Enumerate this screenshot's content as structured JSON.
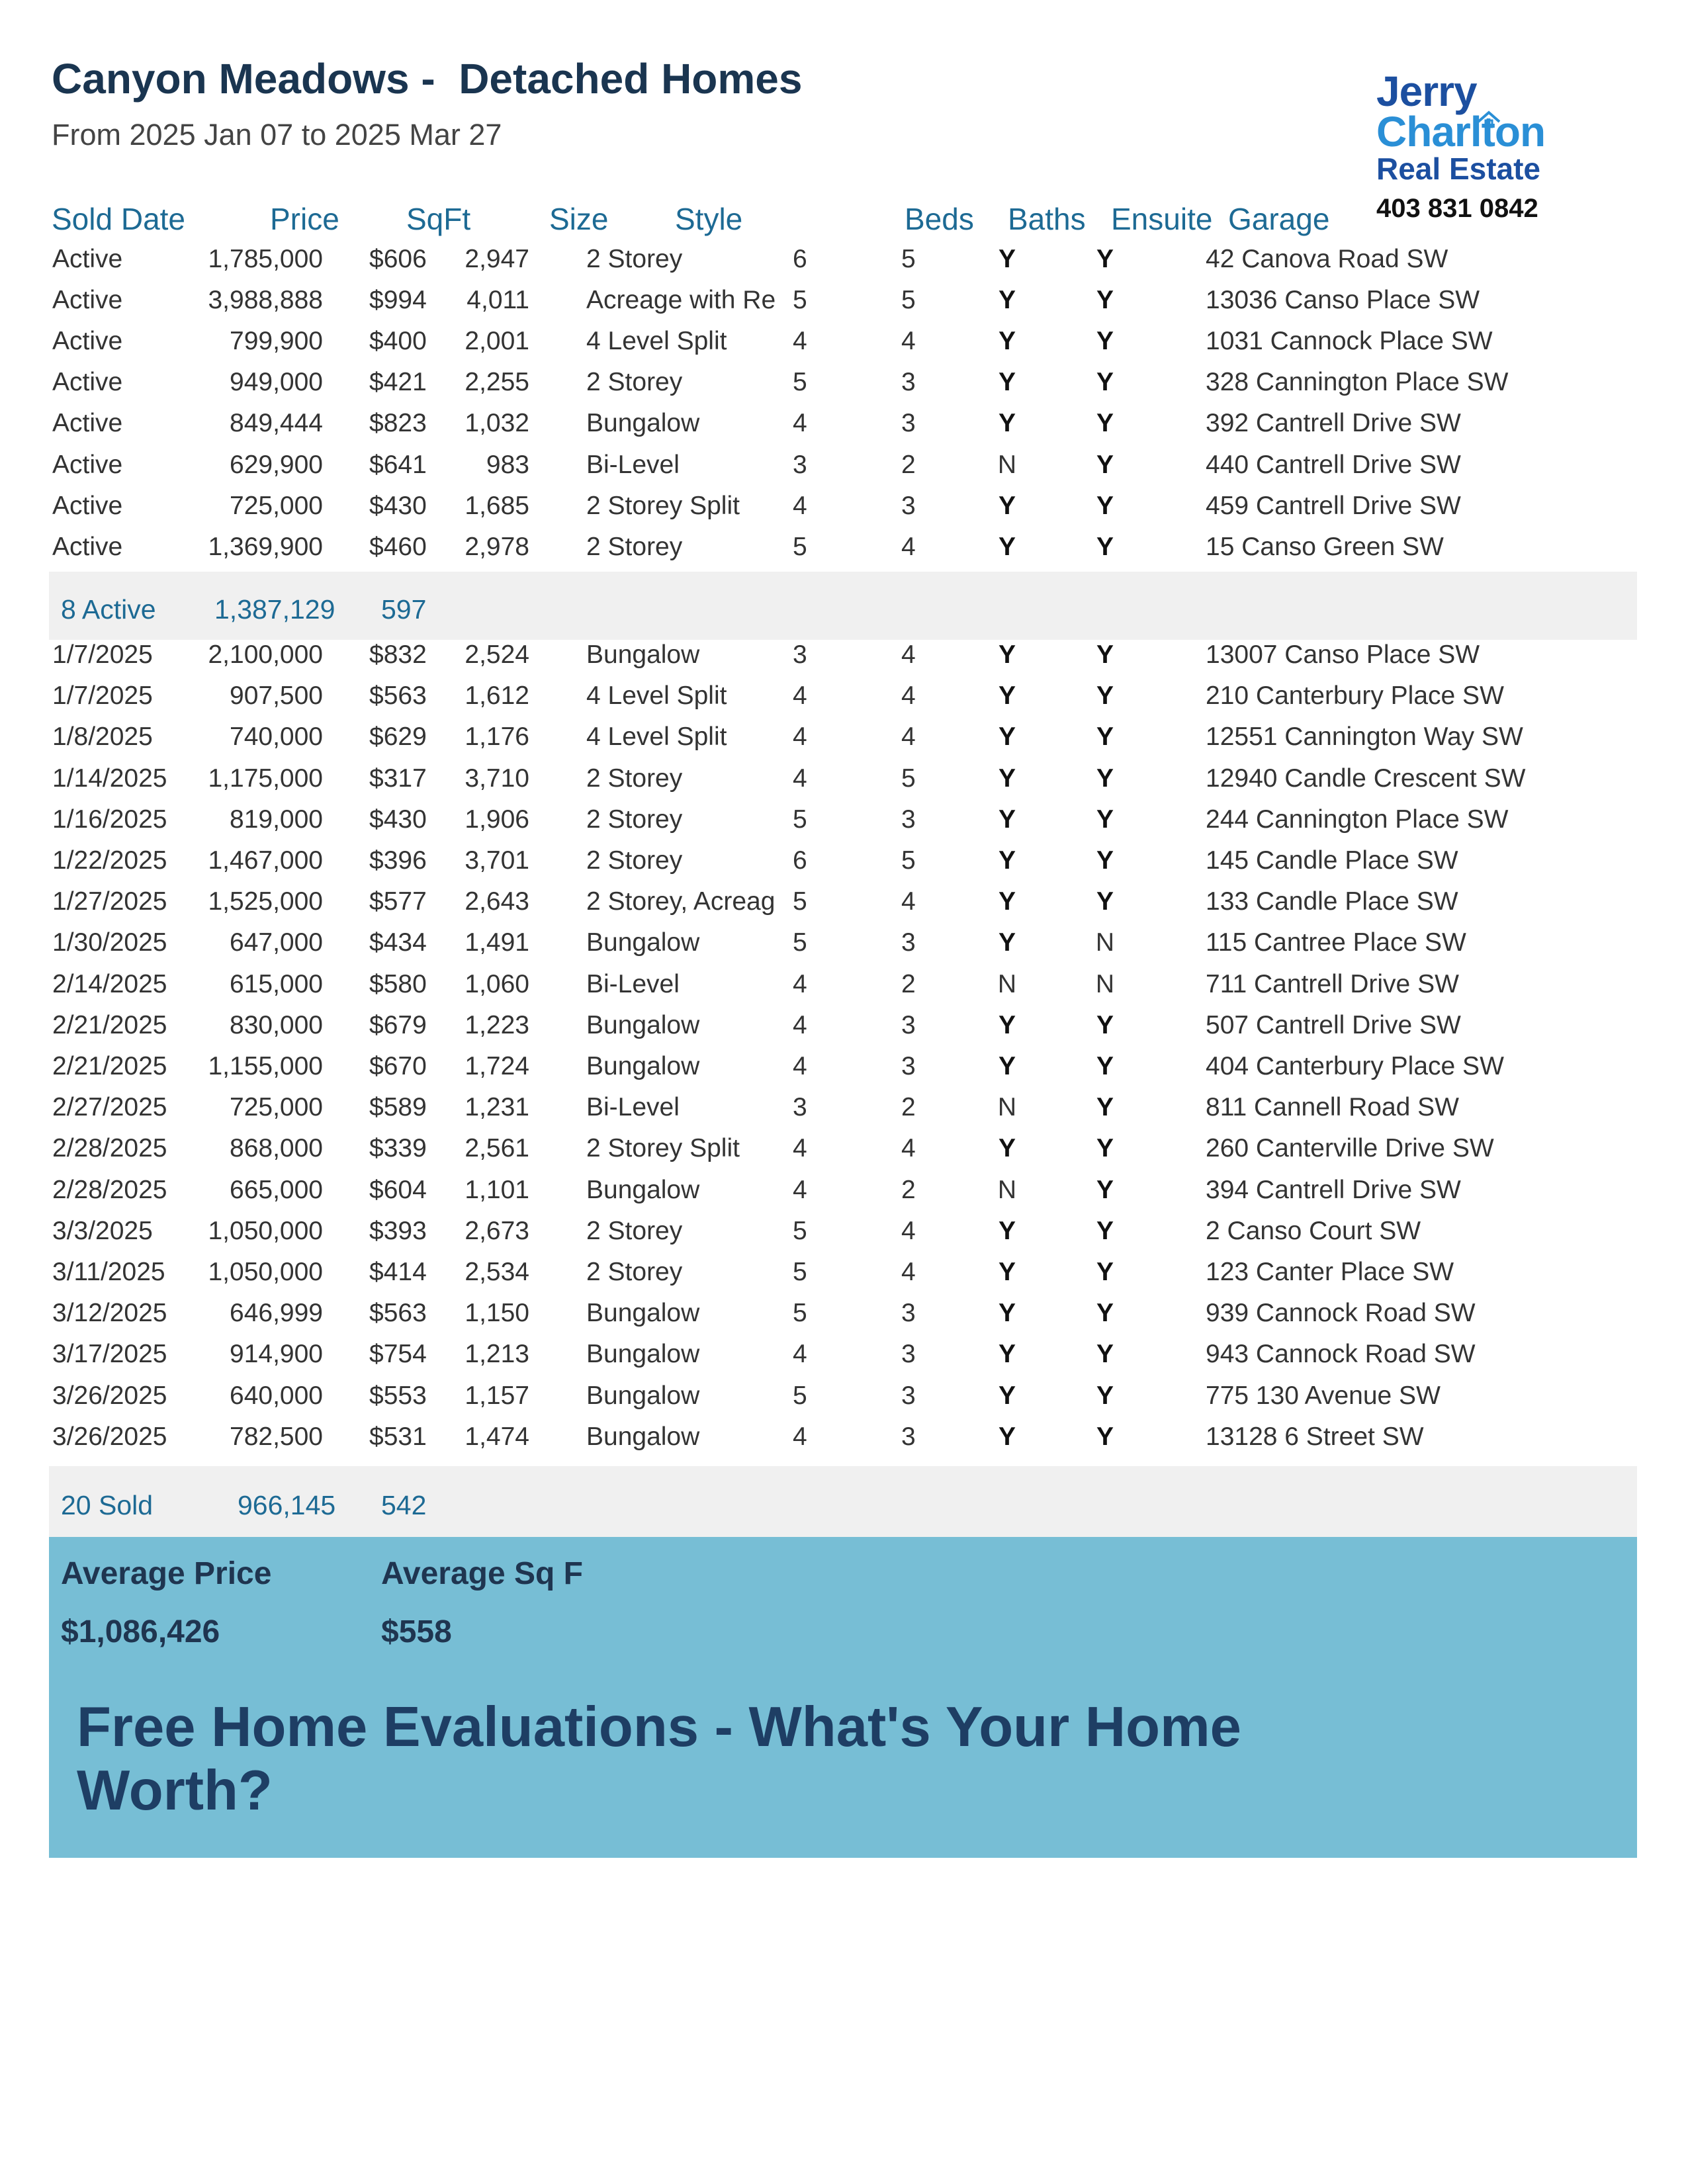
{
  "header": {
    "title": "Canyon Meadows -  Detached Homes",
    "subtitle": "From 2025 Jan 07 to 2025 Mar 27"
  },
  "logo": {
    "line1": "Jerry",
    "line2": "Charlton",
    "line3": "Real Estate",
    "phone": "403 831 0842"
  },
  "columns": {
    "sold_date": "Sold Date",
    "price": "Price",
    "sqft": "SqFt",
    "size": "Size",
    "style": "Style",
    "beds": "Beds",
    "baths": "Baths",
    "ensuite": "Ensuite",
    "garage": "Garage"
  },
  "active_listings": [
    {
      "date": "Active",
      "price": "1,785,000",
      "psf": "$606",
      "sqft": "2,947",
      "style": "2 Storey",
      "beds": "6",
      "baths": "5",
      "ensuite": "Y",
      "garage": "Y",
      "address": "42 Canova Road SW"
    },
    {
      "date": "Active",
      "price": "3,988,888",
      "psf": "$994",
      "sqft": "4,011",
      "style": "Acreage with Re",
      "beds": "5",
      "baths": "5",
      "ensuite": "Y",
      "garage": "Y",
      "address": "13036 Canso Place SW"
    },
    {
      "date": "Active",
      "price": "799,900",
      "psf": "$400",
      "sqft": "2,001",
      "style": "4 Level Split",
      "beds": "4",
      "baths": "4",
      "ensuite": "Y",
      "garage": "Y",
      "address": "1031 Cannock Place SW"
    },
    {
      "date": "Active",
      "price": "949,000",
      "psf": "$421",
      "sqft": "2,255",
      "style": "2 Storey",
      "beds": "5",
      "baths": "3",
      "ensuite": "Y",
      "garage": "Y",
      "address": "328 Cannington Place SW"
    },
    {
      "date": "Active",
      "price": "849,444",
      "psf": "$823",
      "sqft": "1,032",
      "style": "Bungalow",
      "beds": "4",
      "baths": "3",
      "ensuite": "Y",
      "garage": "Y",
      "address": "392 Cantrell Drive SW"
    },
    {
      "date": "Active",
      "price": "629,900",
      "psf": "$641",
      "sqft": "983",
      "style": "Bi-Level",
      "beds": "3",
      "baths": "2",
      "ensuite": "N",
      "garage": "Y",
      "address": "440 Cantrell Drive SW"
    },
    {
      "date": "Active",
      "price": "725,000",
      "psf": "$430",
      "sqft": "1,685",
      "style": "2 Storey Split",
      "beds": "4",
      "baths": "3",
      "ensuite": "Y",
      "garage": "Y",
      "address": "459 Cantrell Drive SW"
    },
    {
      "date": "Active",
      "price": "1,369,900",
      "psf": "$460",
      "sqft": "2,978",
      "style": "2 Storey",
      "beds": "5",
      "baths": "4",
      "ensuite": "Y",
      "garage": "Y",
      "address": "15 Canso Green SW"
    }
  ],
  "active_summary": {
    "count": "8 Active",
    "avg_price": "1,387,129",
    "avg_psf": "597"
  },
  "sold_listings": [
    {
      "date": "1/7/2025",
      "price": "2,100,000",
      "psf": "$832",
      "sqft": "2,524",
      "style": "Bungalow",
      "beds": "3",
      "baths": "4",
      "ensuite": "Y",
      "garage": "Y",
      "address": "13007 Canso Place SW"
    },
    {
      "date": "1/7/2025",
      "price": "907,500",
      "psf": "$563",
      "sqft": "1,612",
      "style": "4 Level Split",
      "beds": "4",
      "baths": "4",
      "ensuite": "Y",
      "garage": "Y",
      "address": "210 Canterbury Place SW"
    },
    {
      "date": "1/8/2025",
      "price": "740,000",
      "psf": "$629",
      "sqft": "1,176",
      "style": "4 Level Split",
      "beds": "4",
      "baths": "4",
      "ensuite": "Y",
      "garage": "Y",
      "address": "12551 Cannington Way SW"
    },
    {
      "date": "1/14/2025",
      "price": "1,175,000",
      "psf": "$317",
      "sqft": "3,710",
      "style": "2 Storey",
      "beds": "4",
      "baths": "5",
      "ensuite": "Y",
      "garage": "Y",
      "address": "12940 Candle Crescent SW"
    },
    {
      "date": "1/16/2025",
      "price": "819,000",
      "psf": "$430",
      "sqft": "1,906",
      "style": "2 Storey",
      "beds": "5",
      "baths": "3",
      "ensuite": "Y",
      "garage": "Y",
      "address": "244 Cannington Place SW"
    },
    {
      "date": "1/22/2025",
      "price": "1,467,000",
      "psf": "$396",
      "sqft": "3,701",
      "style": "2 Storey",
      "beds": "6",
      "baths": "5",
      "ensuite": "Y",
      "garage": "Y",
      "address": "145 Candle Place SW"
    },
    {
      "date": "1/27/2025",
      "price": "1,525,000",
      "psf": "$577",
      "sqft": "2,643",
      "style": "2 Storey, Acreag",
      "beds": "5",
      "baths": "4",
      "ensuite": "Y",
      "garage": "Y",
      "address": "133 Candle Place SW"
    },
    {
      "date": "1/30/2025",
      "price": "647,000",
      "psf": "$434",
      "sqft": "1,491",
      "style": "Bungalow",
      "beds": "5",
      "baths": "3",
      "ensuite": "Y",
      "garage": "N",
      "address": "115 Cantree Place SW"
    },
    {
      "date": "2/14/2025",
      "price": "615,000",
      "psf": "$580",
      "sqft": "1,060",
      "style": "Bi-Level",
      "beds": "4",
      "baths": "2",
      "ensuite": "N",
      "garage": "N",
      "address": "711 Cantrell Drive SW"
    },
    {
      "date": "2/21/2025",
      "price": "830,000",
      "psf": "$679",
      "sqft": "1,223",
      "style": "Bungalow",
      "beds": "4",
      "baths": "3",
      "ensuite": "Y",
      "garage": "Y",
      "address": "507 Cantrell Drive SW"
    },
    {
      "date": "2/21/2025",
      "price": "1,155,000",
      "psf": "$670",
      "sqft": "1,724",
      "style": "Bungalow",
      "beds": "4",
      "baths": "3",
      "ensuite": "Y",
      "garage": "Y",
      "address": "404 Canterbury Place SW"
    },
    {
      "date": "2/27/2025",
      "price": "725,000",
      "psf": "$589",
      "sqft": "1,231",
      "style": "Bi-Level",
      "beds": "3",
      "baths": "2",
      "ensuite": "N",
      "garage": "Y",
      "address": "811 Cannell Road SW"
    },
    {
      "date": "2/28/2025",
      "price": "868,000",
      "psf": "$339",
      "sqft": "2,561",
      "style": "2 Storey Split",
      "beds": "4",
      "baths": "4",
      "ensuite": "Y",
      "garage": "Y",
      "address": "260 Canterville Drive SW"
    },
    {
      "date": "2/28/2025",
      "price": "665,000",
      "psf": "$604",
      "sqft": "1,101",
      "style": "Bungalow",
      "beds": "4",
      "baths": "2",
      "ensuite": "N",
      "garage": "Y",
      "address": "394 Cantrell Drive SW"
    },
    {
      "date": "3/3/2025",
      "price": "1,050,000",
      "psf": "$393",
      "sqft": "2,673",
      "style": "2 Storey",
      "beds": "5",
      "baths": "4",
      "ensuite": "Y",
      "garage": "Y",
      "address": "2 Canso Court SW"
    },
    {
      "date": "3/11/2025",
      "price": "1,050,000",
      "psf": "$414",
      "sqft": "2,534",
      "style": "2 Storey",
      "beds": "5",
      "baths": "4",
      "ensuite": "Y",
      "garage": "Y",
      "address": "123 Canter Place SW"
    },
    {
      "date": "3/12/2025",
      "price": "646,999",
      "psf": "$563",
      "sqft": "1,150",
      "style": "Bungalow",
      "beds": "5",
      "baths": "3",
      "ensuite": "Y",
      "garage": "Y",
      "address": "939 Cannock Road SW"
    },
    {
      "date": "3/17/2025",
      "price": "914,900",
      "psf": "$754",
      "sqft": "1,213",
      "style": "Bungalow",
      "beds": "4",
      "baths": "3",
      "ensuite": "Y",
      "garage": "Y",
      "address": "943 Cannock Road SW"
    },
    {
      "date": "3/26/2025",
      "price": "640,000",
      "psf": "$553",
      "sqft": "1,157",
      "style": "Bungalow",
      "beds": "5",
      "baths": "3",
      "ensuite": "Y",
      "garage": "Y",
      "address": "775 130 Avenue SW"
    },
    {
      "date": "3/26/2025",
      "price": "782,500",
      "psf": "$531",
      "sqft": "1,474",
      "style": "Bungalow",
      "beds": "4",
      "baths": "3",
      "ensuite": "Y",
      "garage": "Y",
      "address": "13128 6 Street SW"
    }
  ],
  "sold_summary": {
    "count": "20 Sold",
    "avg_price": "966,145",
    "avg_psf": "542"
  },
  "averages": {
    "price_label": "Average Price",
    "price_value": "$1,086,426",
    "sqft_label": "Average Sq F",
    "sqft_value": "$558"
  },
  "promo": "Free Home Evaluations - What's Your Home Worth?",
  "colors": {
    "title": "#1a3550",
    "header_text": "#1d6a94",
    "summary_band": "#f0f0f0",
    "promo_band": "#77bed5",
    "promo_text": "#1e3e64"
  }
}
